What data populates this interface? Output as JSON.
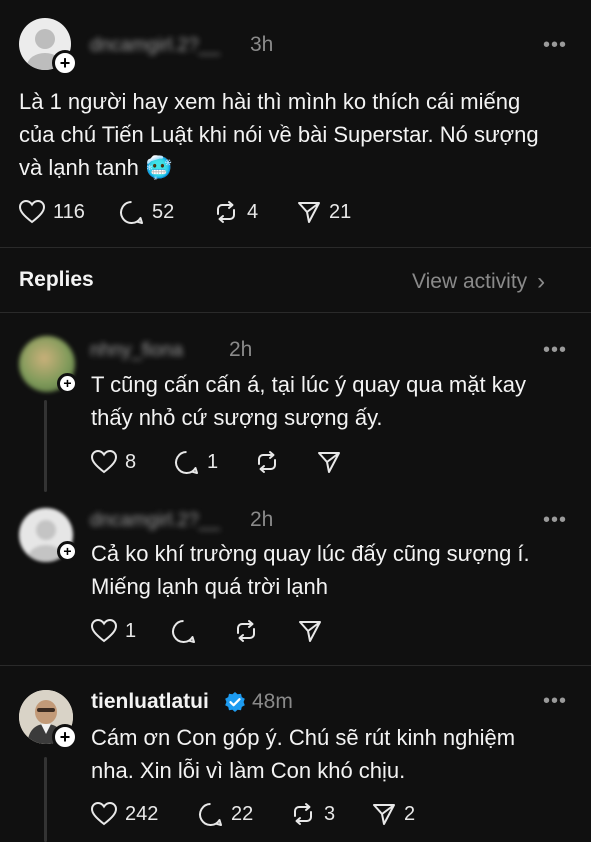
{
  "post": {
    "username": "dncamgirl.2?__",
    "time": "3h",
    "text_line1": "Là 1 người hay xem hài thì mình ko thích cái miếng",
    "text_line2": "của chú Tiến Luật khi nói về bài Superstar. Nó sượng",
    "text_line3": "và lạnh tanh 🥶",
    "likes": "116",
    "comments": "52",
    "reposts": "4",
    "shares": "21",
    "more": "•••"
  },
  "replies_header": {
    "title": "Replies",
    "view_activity": "View activity",
    "chevron": "›"
  },
  "replies": [
    {
      "username": "nhny_fiona",
      "time": "2h",
      "line1": "T cũng cấn cấn á, tại lúc ý quay qua mặt kay",
      "line2": "thấy nhỏ cứ sượng sượng ấy.",
      "likes": "8",
      "comments": "1",
      "reposts": "",
      "shares": "",
      "more": "•••"
    },
    {
      "username": "dncamgirl.2?__",
      "time": "2h",
      "line1": "Cả ko khí trường quay lúc đấy cũng sượng í.",
      "line2": "Miếng lạnh quá trời lạnh",
      "likes": "1",
      "comments": "",
      "reposts": "",
      "shares": "",
      "more": "•••"
    },
    {
      "username": "tienluatlatui",
      "time": "48m",
      "line1": "Cám ơn Con góp ý. Chú sẽ rút kinh nghiệm",
      "line2": "nha. Xin lỗi vì làm Con khó chịu.",
      "likes": "242",
      "comments": "22",
      "reposts": "3",
      "shares": "2",
      "more": "•••"
    }
  ],
  "colors": {
    "background": "#101010",
    "text": "#f3f3f3",
    "muted": "#8a8a8a",
    "verified": "#1d9bf0"
  },
  "icons": [
    "heart-icon",
    "comment-icon",
    "repost-icon",
    "share-icon",
    "more-icon",
    "plus-icon",
    "verified-icon",
    "chevron-right-icon"
  ]
}
